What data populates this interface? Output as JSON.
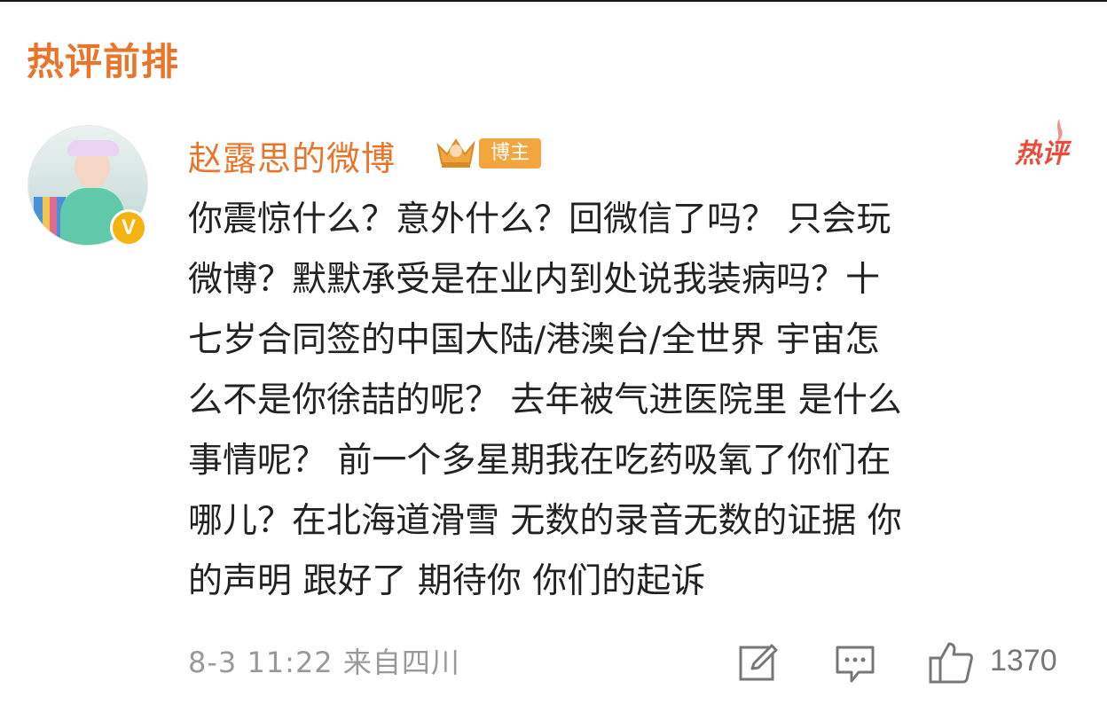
{
  "section": {
    "title": "热评前排"
  },
  "comment": {
    "username": "赵露思的微博",
    "author_tag": "博主",
    "hot_label": "热评",
    "verified_mark": "V",
    "text": "你震惊什么？意外什么？回微信了吗？ 只会玩\n微博？默默承受是在业内到处说我装病吗？十\n七岁合同签的中国大陆/港澳台/全世界 宇宙怎\n么不是你徐喆的呢？ 去年被气进医院里 是什么\n事情呢？ 前一个多星期我在吃药吸氧了你们在\n哪儿？在北海道滑雪 无数的录音无数的证据 你\n的声明 跟好了 期待你 你们的起诉",
    "timestamp": "8-3 11:22",
    "location": "来自四川",
    "like_count": "1370"
  },
  "icons": {
    "edit": "edit-icon",
    "comment": "comment-icon",
    "like": "thumbs-up-icon",
    "crown": "crown-icon",
    "verified": "verified-v-icon"
  },
  "colors": {
    "accent_orange": "#e8752a",
    "tag_orange": "#f2a640",
    "hot_red": "#e94b3c",
    "verified_gold": "#f5b30f",
    "meta_gray": "#999999"
  }
}
